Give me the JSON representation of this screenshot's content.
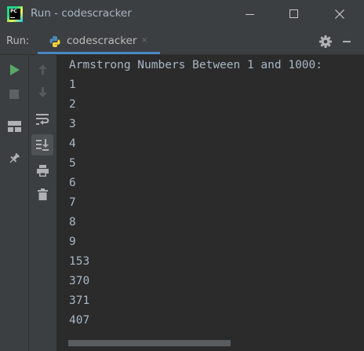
{
  "window": {
    "title": "Run - codescracker",
    "logo_text": "PC"
  },
  "toolwindow": {
    "run_label": "Run:",
    "tab_label": "codescracker",
    "tab_close": "×"
  },
  "console": {
    "lines": [
      "Armstrong Numbers Between 1 and 1000:",
      "1",
      "2",
      "3",
      "4",
      "5",
      "6",
      "7",
      "8",
      "9",
      "153",
      "370",
      "371",
      "407"
    ]
  },
  "colors": {
    "background": "#2b2b2b",
    "toolbar": "#3c3f41",
    "text": "#a9b7c6",
    "tab_underline": "#4a88c7",
    "run_green": "#59a869"
  },
  "icons": {
    "titlebar": [
      "pycharm-logo-icon",
      "minimize-icon",
      "maximize-icon",
      "close-icon"
    ],
    "toolwindow": [
      "python-icon",
      "gear-icon",
      "hide-icon"
    ],
    "left_toolbar": [
      "rerun-icon",
      "stop-icon",
      "layout-icon",
      "pin-icon"
    ],
    "second_toolbar": [
      "up-arrow-icon",
      "down-arrow-icon",
      "soft-wrap-icon",
      "scroll-to-end-icon",
      "print-icon",
      "trash-icon"
    ]
  }
}
